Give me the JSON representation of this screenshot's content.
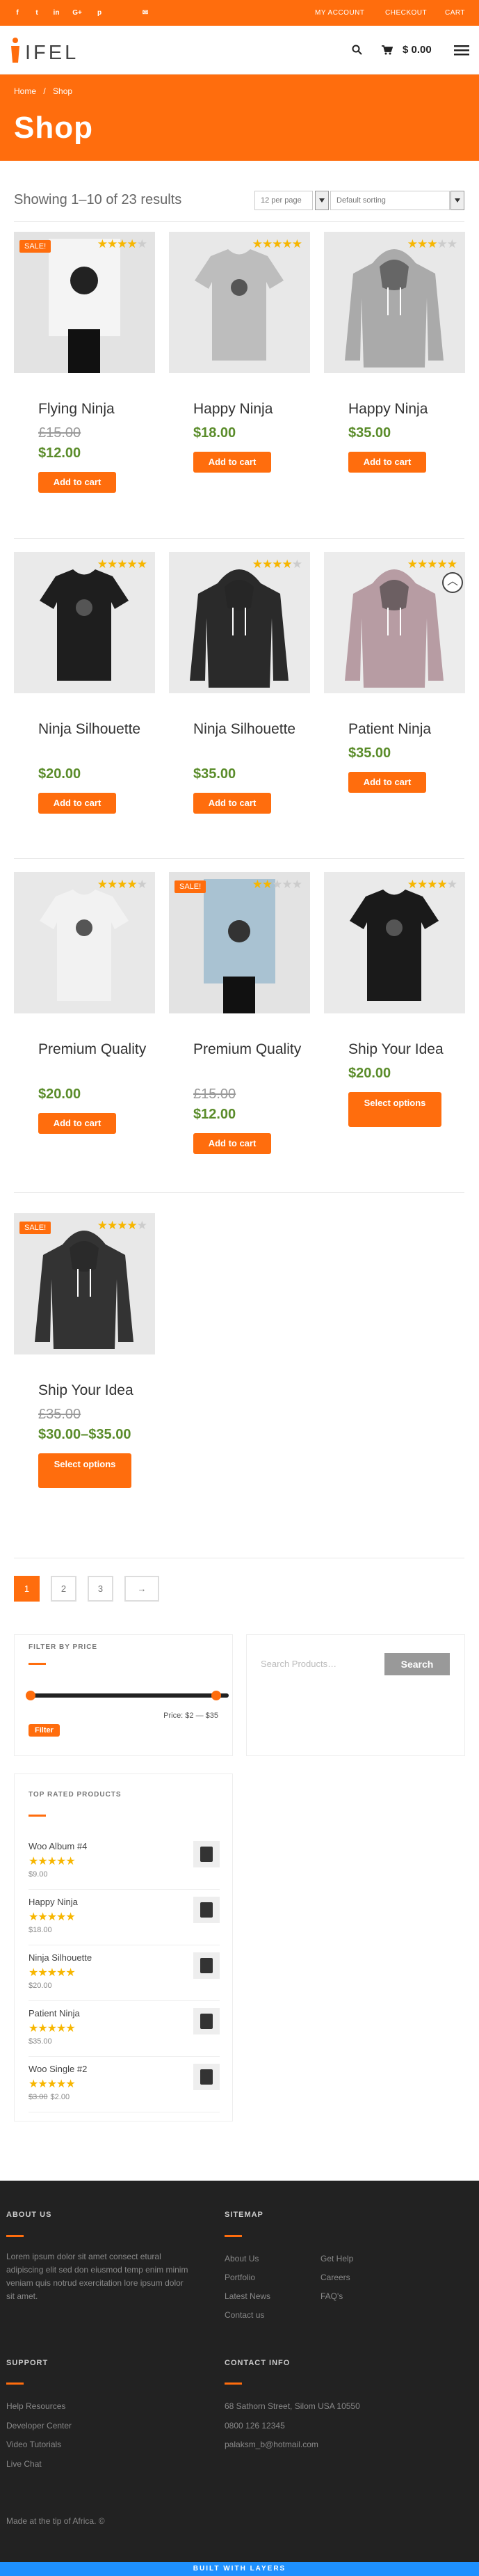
{
  "topbar": {
    "social": [
      "f",
      "t",
      "in",
      "G+",
      "p",
      "✉"
    ],
    "links": [
      "MY ACCOUNT",
      "CHECKOUT",
      "CART"
    ]
  },
  "header": {
    "logo_text": "IFEL",
    "cart_total": "$ 0.00"
  },
  "breadcrumb": {
    "home": "Home",
    "sep": "/",
    "current": "Shop"
  },
  "page_title": "Shop",
  "results": {
    "showing": "Showing 1–10 of 23 results",
    "per_page": "12 per page",
    "sorting": "Default sorting"
  },
  "products": [
    {
      "name": "Flying Ninja",
      "old_price": "£15.00",
      "price": "$12.00",
      "button": "Add to cart",
      "sale": "SALE!",
      "rating": 4
    },
    {
      "name": "Happy Ninja",
      "old_price": "",
      "price": "$18.00",
      "button": "Add to cart",
      "sale": "",
      "rating": 5
    },
    {
      "name": "Happy Ninja",
      "old_price": "",
      "price": "$35.00",
      "button": "Add to cart",
      "sale": "",
      "rating": 3
    },
    {
      "name": "Ninja Silhouette",
      "old_price": "",
      "price": "$20.00",
      "button": "Add to cart",
      "sale": "",
      "rating": 5
    },
    {
      "name": "Ninja Silhouette",
      "old_price": "",
      "price": "$35.00",
      "button": "Add to cart",
      "sale": "",
      "rating": 4
    },
    {
      "name": "Patient Ninja",
      "old_price": "",
      "price": "$35.00",
      "button": "Add to cart",
      "sale": "",
      "rating": 5
    },
    {
      "name": "Premium Quality",
      "old_price": "",
      "price": "$20.00",
      "button": "Add to cart",
      "sale": "",
      "rating": 4.5
    },
    {
      "name": "Premium Quality",
      "old_price": "£15.00",
      "price": "$12.00",
      "button": "Add to cart",
      "sale": "SALE!",
      "rating": 2
    },
    {
      "name": "Ship Your Idea",
      "old_price": "",
      "price": "$20.00",
      "button": "Select options",
      "sale": "",
      "rating": 4.5
    },
    {
      "name": "Ship Your Idea",
      "old_price": "£35.00",
      "price": "$30.00–$35.00",
      "button": "Select options",
      "sale": "SALE!",
      "rating": 4
    }
  ],
  "pagination": [
    "1",
    "2",
    "3",
    "→"
  ],
  "filter": {
    "title": "FILTER BY PRICE",
    "button": "Filter",
    "range": "Price: $2 — $35"
  },
  "search": {
    "placeholder": "Search Products…",
    "button": "Search"
  },
  "top_rated": {
    "title": "TOP RATED PRODUCTS",
    "items": [
      {
        "name": "Woo Album #4",
        "price": "$9.00",
        "old_price": ""
      },
      {
        "name": "Happy Ninja",
        "price": "$18.00",
        "old_price": ""
      },
      {
        "name": "Ninja Silhouette",
        "price": "$20.00",
        "old_price": ""
      },
      {
        "name": "Patient Ninja",
        "price": "$35.00",
        "old_price": ""
      },
      {
        "name": "Woo Single #2",
        "price": "$2.00",
        "old_price": "$3.00"
      }
    ]
  },
  "footer": {
    "about_title": "ABOUT US",
    "about_text": "Lorem ipsum dolor sit amet consect etural adipiscing elit sed don eiusmod temp enim minim veniam quis notrud exercitation lore ipsum dolor sit amet.",
    "sitemap_title": "SITEMAP",
    "sitemap_col1": [
      "About Us",
      "Portfolio",
      "Latest News",
      "Contact us"
    ],
    "sitemap_col2": [
      "Get Help",
      "Careers",
      "FAQ's"
    ],
    "support_title": "SUPPORT",
    "support_links": [
      "Help Resources",
      "Developer Center",
      "Video Tutorials",
      "Live Chat"
    ],
    "contact_title": "CONTACT INFO",
    "contact_lines": [
      "68 Sathorn Street, Silom USA 10550",
      "0800 126 12345",
      "palaksm_b@hotmail.com"
    ],
    "made": "Made at the tip of Africa. ©",
    "built": "BUILT WITH LAYERS"
  },
  "colors": {
    "accent": "#ff6d0d",
    "price_green": "#5a8c2a",
    "footer_bg": "#222222",
    "built_bar": "#1e90ff"
  }
}
